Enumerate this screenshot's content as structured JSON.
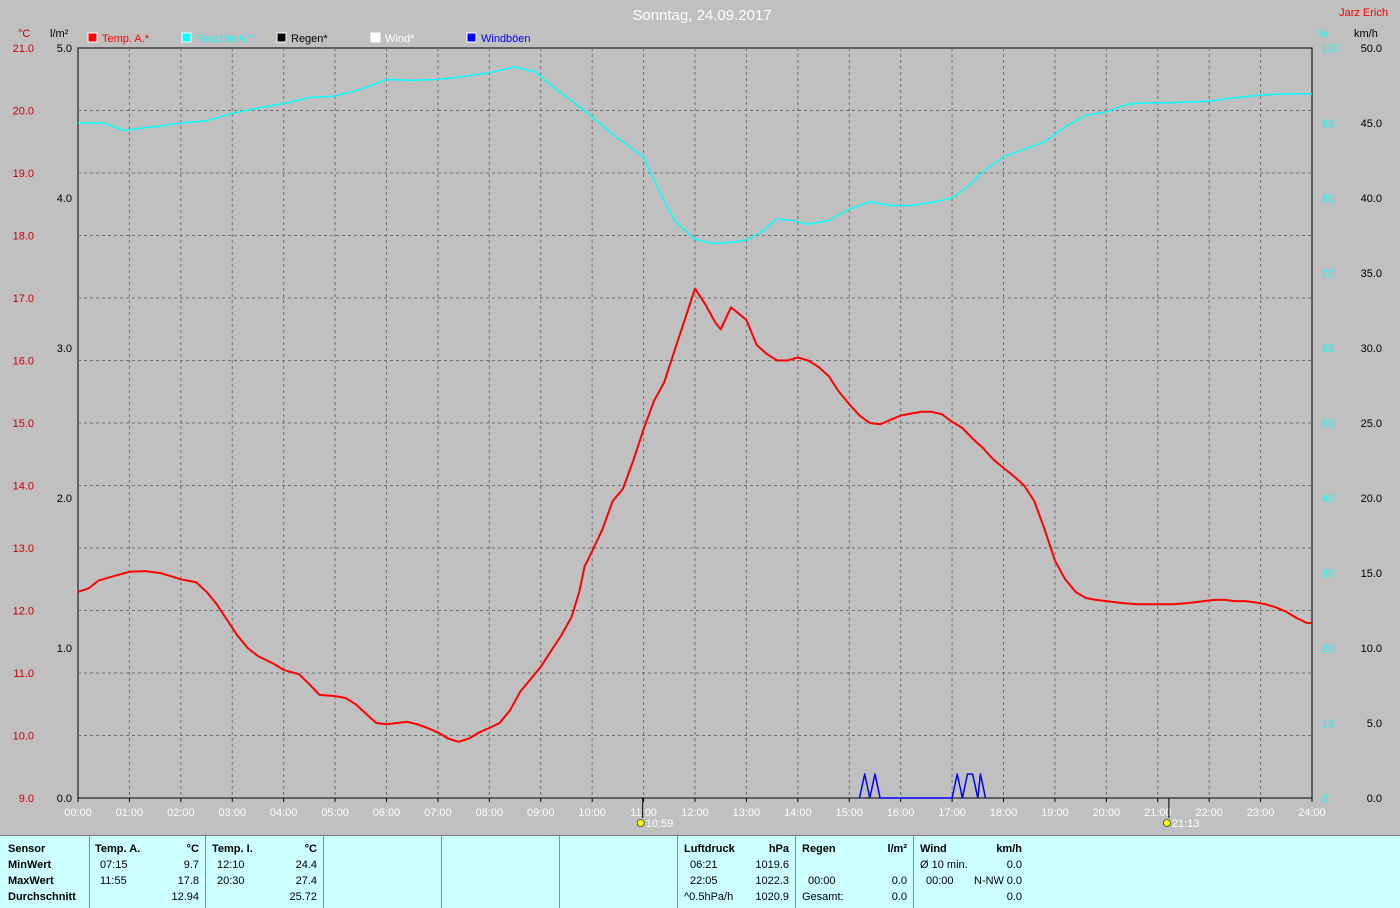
{
  "header": {
    "title": "Sonntag, 24.09.2017",
    "author": "Jarz Erich"
  },
  "legend": [
    {
      "label": "Temp. A.*",
      "color": "#ff0000"
    },
    {
      "label": "Feuchte A.*",
      "color": "#00ffff"
    },
    {
      "label": "Regen*",
      "color": "#000000"
    },
    {
      "label": "Wind*",
      "color": "#ffffff"
    },
    {
      "label": "Windböen",
      "color": "#0000ff"
    }
  ],
  "axis_units": {
    "temp": "°C",
    "rain": "l/m²",
    "humidity": "%",
    "wind": "km/h"
  },
  "sun_markers": [
    "10:59",
    "21:13"
  ],
  "chart_data": {
    "type": "line",
    "x_ticks": [
      "00:00",
      "01:00",
      "02:00",
      "03:00",
      "04:00",
      "05:00",
      "06:00",
      "07:00",
      "08:00",
      "09:00",
      "10:00",
      "11:00",
      "12:00",
      "13:00",
      "14:00",
      "15:00",
      "16:00",
      "17:00",
      "18:00",
      "19:00",
      "20:00",
      "21:00",
      "22:00",
      "23:00",
      "24:00"
    ],
    "xlim": [
      0,
      24
    ],
    "axes": {
      "temp": {
        "lim": [
          9.0,
          21.0
        ],
        "ticks": [
          "9.0",
          "10.0",
          "11.0",
          "12.0",
          "13.0",
          "14.0",
          "15.0",
          "16.0",
          "17.0",
          "18.0",
          "19.0",
          "20.0",
          "21.0"
        ],
        "color": "#cc0000"
      },
      "rain": {
        "lim": [
          0.0,
          5.0
        ],
        "ticks": [
          "0.0",
          "1.0",
          "2.0",
          "3.0",
          "4.0",
          "5.0"
        ],
        "color": "#000000"
      },
      "humidity": {
        "lim": [
          0,
          100
        ],
        "ticks": [
          "0",
          "10",
          "20",
          "30",
          "40",
          "50",
          "60",
          "70",
          "80",
          "90",
          "100"
        ],
        "color": "#00ffff"
      },
      "wind": {
        "lim": [
          0.0,
          50.0
        ],
        "ticks": [
          "0.0",
          "5.0",
          "10.0",
          "15.0",
          "20.0",
          "25.0",
          "30.0",
          "35.0",
          "40.0",
          "45.0",
          "50.0"
        ],
        "color": "#000000"
      }
    },
    "grid": true,
    "series": [
      {
        "name": "Temp. A.*",
        "axis": "temp",
        "color": "#ff0000",
        "points": [
          [
            0,
            12.3
          ],
          [
            0.2,
            12.35
          ],
          [
            0.4,
            12.48
          ],
          [
            0.7,
            12.55
          ],
          [
            1.0,
            12.62
          ],
          [
            1.3,
            12.63
          ],
          [
            1.6,
            12.6
          ],
          [
            1.8,
            12.55
          ],
          [
            2.0,
            12.5
          ],
          [
            2.3,
            12.45
          ],
          [
            2.5,
            12.3
          ],
          [
            2.7,
            12.1
          ],
          [
            2.9,
            11.85
          ],
          [
            3.1,
            11.6
          ],
          [
            3.3,
            11.4
          ],
          [
            3.5,
            11.27
          ],
          [
            3.8,
            11.15
          ],
          [
            4.0,
            11.05
          ],
          [
            4.3,
            10.98
          ],
          [
            4.5,
            10.82
          ],
          [
            4.7,
            10.65
          ],
          [
            5.0,
            10.63
          ],
          [
            5.2,
            10.6
          ],
          [
            5.4,
            10.5
          ],
          [
            5.6,
            10.35
          ],
          [
            5.8,
            10.2
          ],
          [
            6.0,
            10.18
          ],
          [
            6.2,
            10.2
          ],
          [
            6.4,
            10.22
          ],
          [
            6.6,
            10.18
          ],
          [
            6.8,
            10.12
          ],
          [
            7.0,
            10.05
          ],
          [
            7.2,
            9.95
          ],
          [
            7.4,
            9.9
          ],
          [
            7.6,
            9.95
          ],
          [
            7.8,
            10.05
          ],
          [
            8.0,
            10.12
          ],
          [
            8.2,
            10.2
          ],
          [
            8.4,
            10.4
          ],
          [
            8.6,
            10.7
          ],
          [
            8.8,
            10.9
          ],
          [
            9.0,
            11.1
          ],
          [
            9.2,
            11.35
          ],
          [
            9.4,
            11.6
          ],
          [
            9.6,
            11.9
          ],
          [
            9.75,
            12.3
          ],
          [
            9.85,
            12.7
          ],
          [
            10.0,
            12.95
          ],
          [
            10.2,
            13.3
          ],
          [
            10.4,
            13.75
          ],
          [
            10.6,
            13.95
          ],
          [
            10.8,
            14.4
          ],
          [
            11.0,
            14.9
          ],
          [
            11.2,
            15.35
          ],
          [
            11.4,
            15.65
          ],
          [
            11.6,
            16.15
          ],
          [
            11.8,
            16.65
          ],
          [
            12.0,
            17.15
          ],
          [
            12.2,
            16.9
          ],
          [
            12.4,
            16.6
          ],
          [
            12.5,
            16.5
          ],
          [
            12.7,
            16.85
          ],
          [
            12.85,
            16.75
          ],
          [
            13.0,
            16.65
          ],
          [
            13.2,
            16.25
          ],
          [
            13.4,
            16.1
          ],
          [
            13.6,
            16.0
          ],
          [
            13.8,
            16.0
          ],
          [
            14.0,
            16.05
          ],
          [
            14.2,
            16.0
          ],
          [
            14.4,
            15.9
          ],
          [
            14.6,
            15.75
          ],
          [
            14.8,
            15.5
          ],
          [
            15.0,
            15.3
          ],
          [
            15.2,
            15.12
          ],
          [
            15.4,
            15.0
          ],
          [
            15.6,
            14.98
          ],
          [
            15.8,
            15.05
          ],
          [
            16.0,
            15.12
          ],
          [
            16.2,
            15.15
          ],
          [
            16.4,
            15.18
          ],
          [
            16.6,
            15.18
          ],
          [
            16.8,
            15.14
          ],
          [
            17.0,
            15.02
          ],
          [
            17.2,
            14.92
          ],
          [
            17.4,
            14.75
          ],
          [
            17.6,
            14.6
          ],
          [
            17.8,
            14.42
          ],
          [
            18.0,
            14.28
          ],
          [
            18.2,
            14.15
          ],
          [
            18.4,
            14.0
          ],
          [
            18.6,
            13.75
          ],
          [
            18.8,
            13.3
          ],
          [
            19.0,
            12.8
          ],
          [
            19.2,
            12.5
          ],
          [
            19.4,
            12.3
          ],
          [
            19.6,
            12.2
          ],
          [
            19.8,
            12.17
          ],
          [
            20.0,
            12.15
          ],
          [
            20.3,
            12.12
          ],
          [
            20.6,
            12.1
          ],
          [
            21.0,
            12.1
          ],
          [
            21.3,
            12.1
          ],
          [
            21.6,
            12.12
          ],
          [
            21.9,
            12.15
          ],
          [
            22.1,
            12.17
          ],
          [
            22.3,
            12.17
          ],
          [
            22.5,
            12.15
          ],
          [
            22.7,
            12.15
          ],
          [
            22.9,
            12.13
          ],
          [
            23.1,
            12.1
          ],
          [
            23.3,
            12.05
          ],
          [
            23.5,
            11.98
          ],
          [
            23.7,
            11.88
          ],
          [
            23.9,
            11.8
          ],
          [
            24.0,
            11.8
          ]
        ]
      },
      {
        "name": "Feuchte A.*",
        "axis": "humidity",
        "color": "#00ffff",
        "points": [
          [
            0,
            90.0
          ],
          [
            0.5,
            90.0
          ],
          [
            0.9,
            89.0
          ],
          [
            1.2,
            89.3
          ],
          [
            1.6,
            89.6
          ],
          [
            2.0,
            90.0
          ],
          [
            2.5,
            90.3
          ],
          [
            3.0,
            91.3
          ],
          [
            3.5,
            92.0
          ],
          [
            4.0,
            92.6
          ],
          [
            4.5,
            93.4
          ],
          [
            5.0,
            93.6
          ],
          [
            5.5,
            94.5
          ],
          [
            6.0,
            95.8
          ],
          [
            6.5,
            95.7
          ],
          [
            7.0,
            95.8
          ],
          [
            7.5,
            96.2
          ],
          [
            8.0,
            96.7
          ],
          [
            8.5,
            97.5
          ],
          [
            8.9,
            96.8
          ],
          [
            9.2,
            95.0
          ],
          [
            9.6,
            93.0
          ],
          [
            10.0,
            90.8
          ],
          [
            10.4,
            88.5
          ],
          [
            10.8,
            86.5
          ],
          [
            11.0,
            85.5
          ],
          [
            11.3,
            81.0
          ],
          [
            11.6,
            77.0
          ],
          [
            12.0,
            74.5
          ],
          [
            12.3,
            74.0
          ],
          [
            12.6,
            74.0
          ],
          [
            13.0,
            74.4
          ],
          [
            13.3,
            75.5
          ],
          [
            13.6,
            77.2
          ],
          [
            13.9,
            77.0
          ],
          [
            14.2,
            76.5
          ],
          [
            14.6,
            77.0
          ],
          [
            15.0,
            78.5
          ],
          [
            15.4,
            79.5
          ],
          [
            15.8,
            79.0
          ],
          [
            16.2,
            79.0
          ],
          [
            16.6,
            79.4
          ],
          [
            17.0,
            80.0
          ],
          [
            17.3,
            81.5
          ],
          [
            17.6,
            83.5
          ],
          [
            18.0,
            85.5
          ],
          [
            18.4,
            86.5
          ],
          [
            18.8,
            87.5
          ],
          [
            19.2,
            89.5
          ],
          [
            19.6,
            91.0
          ],
          [
            20.0,
            91.5
          ],
          [
            20.4,
            92.5
          ],
          [
            20.8,
            92.7
          ],
          [
            21.2,
            92.7
          ],
          [
            21.6,
            92.8
          ],
          [
            22.0,
            92.9
          ],
          [
            22.4,
            93.3
          ],
          [
            22.8,
            93.6
          ],
          [
            23.2,
            93.8
          ],
          [
            23.6,
            93.9
          ],
          [
            24.0,
            93.9
          ]
        ]
      },
      {
        "name": "Windböen",
        "axis": "wind",
        "color": "#0000ff",
        "points": [
          [
            15.2,
            0
          ],
          [
            15.3,
            1.6
          ],
          [
            15.4,
            0
          ],
          [
            15.5,
            1.6
          ],
          [
            15.6,
            0
          ],
          [
            17.0,
            0
          ],
          [
            17.1,
            1.6
          ],
          [
            17.2,
            0
          ],
          [
            17.3,
            1.6
          ],
          [
            17.4,
            1.6
          ],
          [
            17.5,
            0
          ],
          [
            17.55,
            1.6
          ],
          [
            17.65,
            0
          ]
        ]
      }
    ]
  },
  "stats": {
    "row_labels": [
      "Sensor",
      "MinWert",
      "MaxWert",
      "Durchschnitt"
    ],
    "temp_a": {
      "header": "Temp. A.",
      "unit": "°C",
      "min_time": "07:15",
      "min": "9.7",
      "max_time": "11:55",
      "max": "17.8",
      "avg": "12.94"
    },
    "temp_i": {
      "header": "Temp. I.",
      "unit": "°C",
      "min_time": "12:10",
      "min": "24.4",
      "max_time": "20:30",
      "max": "27.4",
      "avg": "25.72"
    },
    "pressure": {
      "header": "Luftdruck",
      "unit": "hPa",
      "min_time": "06:21",
      "min": "1019.6",
      "max_time": "22:05",
      "max": "1022.3",
      "avg_label": "^0.5hPa/h",
      "avg": "1020.9"
    },
    "rain": {
      "header": "Regen",
      "unit": "l/m²",
      "max_time": "00:00",
      "max": "0.0",
      "min": "0.0",
      "total_label": "Gesamt:",
      "total": "0.0"
    },
    "wind": {
      "header": "Wind",
      "unit": "km/h",
      "avg_label": "Ø 10 min.",
      "avg": "0.0",
      "max_time": "00:00",
      "max_dir": "N-NW",
      "max": "0.0",
      "total": "0.0"
    }
  }
}
